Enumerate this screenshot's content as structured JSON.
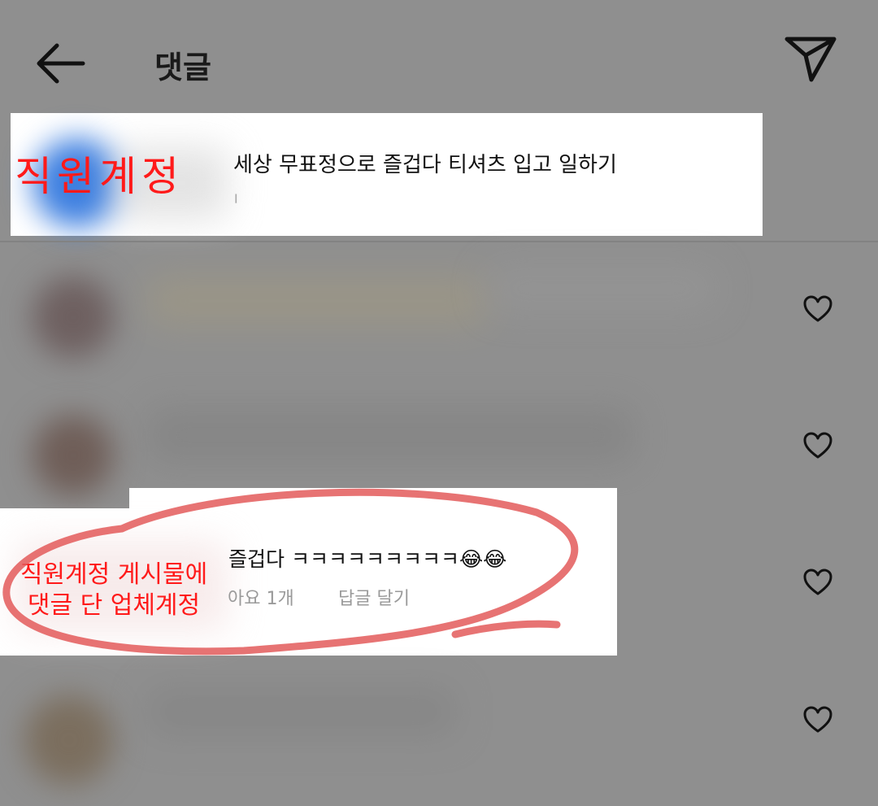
{
  "header": {
    "back_icon": "arrow-left-icon",
    "title": "댓글",
    "send_icon": "paper-plane-icon"
  },
  "post_caption": {
    "text": "세상 무표정으로 즐겁다 티셔츠 입고 일하기",
    "meta_fragment": "ᅵ"
  },
  "annotations": {
    "employee_account": "직원계정",
    "vendor_line1": "직원계정 게시물에",
    "vendor_line2": "댓글 단 업체계정",
    "annotation_color": "#ff1a1a"
  },
  "reply_comment": {
    "text": "즐겁다 ㅋㅋㅋㅋㅋㅋㅋㅋㅋ😂😂",
    "likes": "아요 1개",
    "reply_button": "답글 달기"
  },
  "comments": [
    {
      "like_icon": "heart-outline-icon"
    },
    {
      "like_icon": "heart-outline-icon"
    },
    {
      "like_icon": "heart-outline-icon"
    },
    {
      "like_icon": "heart-outline-icon"
    }
  ],
  "colors": {
    "dim_overlay": "#8f8f8f",
    "highlight": "#ffffff",
    "meta_text": "#9a9a9a"
  }
}
